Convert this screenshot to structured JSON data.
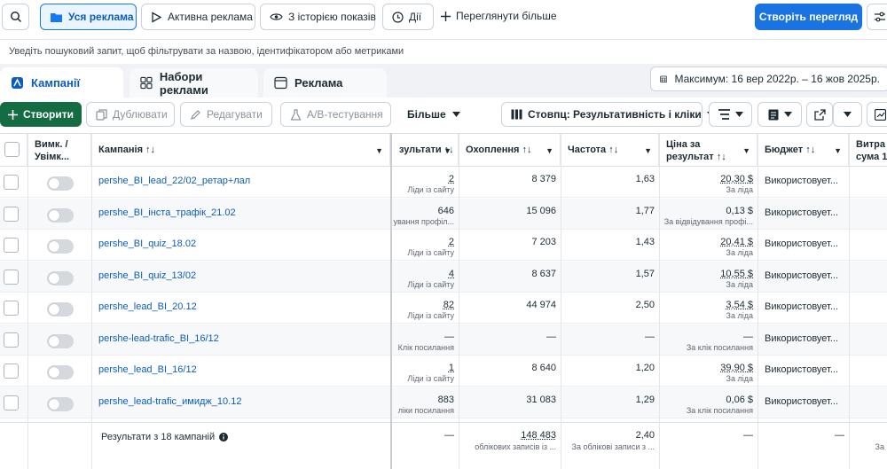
{
  "topbar": {
    "all_ads": "Уся реклама",
    "active_ads": "Активна реклама",
    "with_history": "З історією показів",
    "actions": "Дії",
    "view_more": "Переглянути більше",
    "create_view": "Створіть перегляд"
  },
  "search": {
    "hint": "Уведіть пошуковий запит, щоб фільтрувати за назвою, ідентифікатором або метриками"
  },
  "tabs": {
    "campaigns": "Кампанії",
    "adsets": "Набори реклами",
    "ads": "Реклама"
  },
  "date_range": "Максимум: 16 вер 2022р. – 16 жов 2025р.",
  "toolbar": {
    "create": "Створити",
    "duplicate": "Дублювати",
    "edit": "Редагувати",
    "ab_test": "А/В-тестування",
    "more": "Більше",
    "columns": "Стовпц: Результативність і кліки"
  },
  "columns": {
    "toggle": "Вимк. / Увімк...",
    "campaign": "Кампанія ↑↓",
    "results": "зультати ↑↓",
    "reach": "Охоплення ↑↓",
    "frequency": "Частота ↑↓",
    "cost_line1": "Ціна за",
    "cost_line2": "результат ↑↓",
    "budget": "Бюджет ↑↓",
    "spent_line1": "Витра",
    "spent_line2": "сума 1"
  },
  "rows": [
    {
      "name": "pershe_BI_lead_22/02_ретар+лал",
      "results": "2",
      "results_sub": "Ліди із сайту",
      "reach": "8 379",
      "frequency": "1,63",
      "cost": "20,30 $",
      "cost_sub": "За ліда",
      "budget": "Використовует..."
    },
    {
      "name": "pershe_BI_інста_трафік_21.02",
      "results": "646",
      "results_sub": "ування профіл...",
      "reach": "15 096",
      "frequency": "1,77",
      "cost": "0,13 $",
      "cost_sub": "За відвідування профі...",
      "budget": "Використовует..."
    },
    {
      "name": "pershe_BI_quiz_18.02",
      "results": "2",
      "results_sub": "Ліди із сайту",
      "reach": "7 203",
      "frequency": "1,43",
      "cost": "20,41 $",
      "cost_sub": "За ліда",
      "budget": "Використовует..."
    },
    {
      "name": "pershe_BI_quiz_13/02",
      "results": "4",
      "results_sub": "Ліди із сайту",
      "reach": "8 637",
      "frequency": "1,57",
      "cost": "10,55 $",
      "cost_sub": "За ліда",
      "budget": "Використовует..."
    },
    {
      "name": "pershe_lead_BI_20.12",
      "results": "82",
      "results_sub": "Ліди із сайту",
      "reach": "44 974",
      "frequency": "2,50",
      "cost": "3,54 $",
      "cost_sub": "За ліда",
      "budget": "Використовует..."
    },
    {
      "name": "pershe-lead-trafic_BI_16/12",
      "results": "—",
      "results_sub": "Клік посилання",
      "reach": "—",
      "frequency": "—",
      "cost": "—",
      "cost_sub": "За клік посилання",
      "budget": "Використовует..."
    },
    {
      "name": "pershe_lead_BI_16/12",
      "results": "1",
      "results_sub": "Ліди із сайту",
      "reach": "8 640",
      "frequency": "1,20",
      "cost": "39,90 $",
      "cost_sub": "За ліда",
      "budget": "Використовует..."
    },
    {
      "name": "pershe_lead-trafic_имидж_10.12",
      "results": "883",
      "results_sub": "ліки посилання",
      "reach": "31 083",
      "frequency": "1,29",
      "cost": "0,06 $",
      "cost_sub": "За клік посилання",
      "budget": "Використовует..."
    }
  ],
  "totals": {
    "label": "Результати з 18 кампаній",
    "results": "—",
    "reach": "148 483",
    "reach_sub": "облікових записів із ...",
    "frequency": "2,40",
    "frequency_sub": "За облікові записи з ...",
    "cost": "—",
    "budget": "—",
    "spent_sub": "За"
  }
}
